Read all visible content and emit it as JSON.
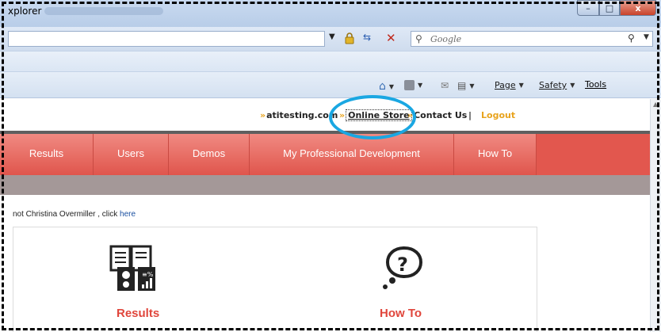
{
  "window": {
    "title": "xplorer",
    "controls": {
      "minimize": "–",
      "maximize": "□",
      "close": "x"
    }
  },
  "addressbar": {
    "search_placeholder": "Google"
  },
  "commandbar": {
    "page_label": "Page",
    "safety_label": "Safety",
    "tools_label": "Tools"
  },
  "site": {
    "top_links": {
      "atitesting": "atitesting.com",
      "online_store": "Online Store",
      "contact": "Contact Us",
      "separator": "|",
      "logout": "Logout"
    },
    "nav": [
      "Results",
      "Users",
      "Demos",
      "My Professional Development",
      "How To"
    ],
    "not_user": {
      "prefix": "not Christina Overmiller , click ",
      "link": "here"
    },
    "cards": [
      {
        "label": "Results",
        "icon": "reports-icon"
      },
      {
        "label": "How To",
        "icon": "question-bubble-icon"
      }
    ]
  },
  "colors": {
    "nav_red": "#e0554c",
    "accent_orange": "#e8a31d",
    "highlight_blue": "#1aa7e2",
    "card_red": "#e0463c"
  }
}
